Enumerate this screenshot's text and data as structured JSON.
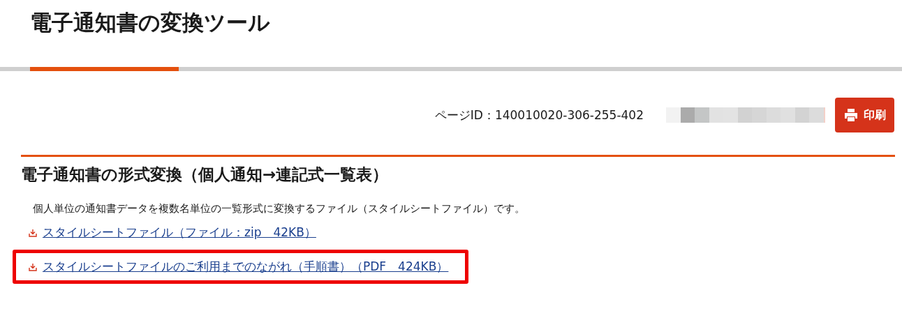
{
  "page_title": "電子通知書の変換ツール",
  "page_id": "ページID：140010020-306-255-402",
  "print_button": "印刷",
  "section": {
    "heading": "電子通知書の形式変換（個人通知→連記式一覧表）",
    "description": "個人単位の通知書データを複数名単位の一覧形式に変換するファイル（スタイルシートファイル）です。",
    "links": [
      {
        "label": "スタイルシートファイル（ファイル：zip　42KB）",
        "highlighted": false
      },
      {
        "label": "スタイルシートファイルのご利用までのながれ（手順書）（PDF　424KB）",
        "highlighted": true
      }
    ]
  }
}
